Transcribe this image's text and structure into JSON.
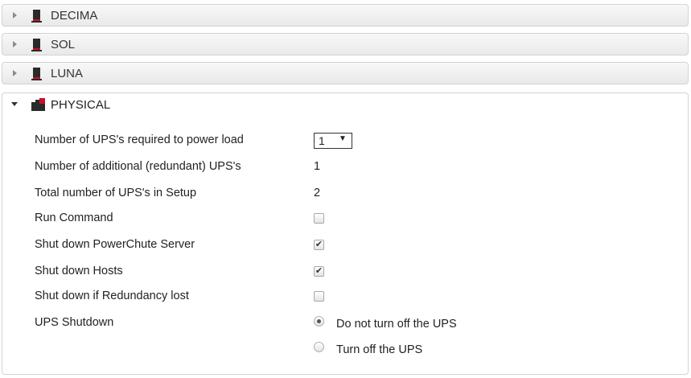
{
  "groups": [
    {
      "label": "DECIMA",
      "expanded": false,
      "icon": "server-icon"
    },
    {
      "label": "SOL",
      "expanded": false,
      "icon": "server-icon"
    },
    {
      "label": "LUNA",
      "expanded": false,
      "icon": "server-icon"
    },
    {
      "label": "PHYSICAL",
      "expanded": true,
      "icon": "multi-server-icon"
    }
  ],
  "physical": {
    "ups_required_label": "Number of UPS's required to power load",
    "ups_required_value": "1",
    "ups_required_arrow": "▼",
    "redundant_label": "Number of additional (redundant) UPS's",
    "redundant_value": "1",
    "total_label": "Total number of UPS's in Setup",
    "total_value": "2",
    "run_command_label": "Run Command",
    "run_command_checked": false,
    "shutdown_server_label": "Shut down PowerChute Server",
    "shutdown_server_checked": true,
    "shutdown_hosts_label": "Shut down Hosts",
    "shutdown_hosts_checked": true,
    "shutdown_redundancy_label": "Shut down if Redundancy lost",
    "shutdown_redundancy_checked": false,
    "ups_shutdown_label": "UPS Shutdown",
    "ups_shutdown_options": [
      "Do not turn off the UPS",
      "Turn off the UPS"
    ],
    "ups_shutdown_selected": 0,
    "check_mark": "✔"
  },
  "colors": {
    "icon_red": "#c8102e",
    "icon_dark": "#2a2a2a"
  }
}
